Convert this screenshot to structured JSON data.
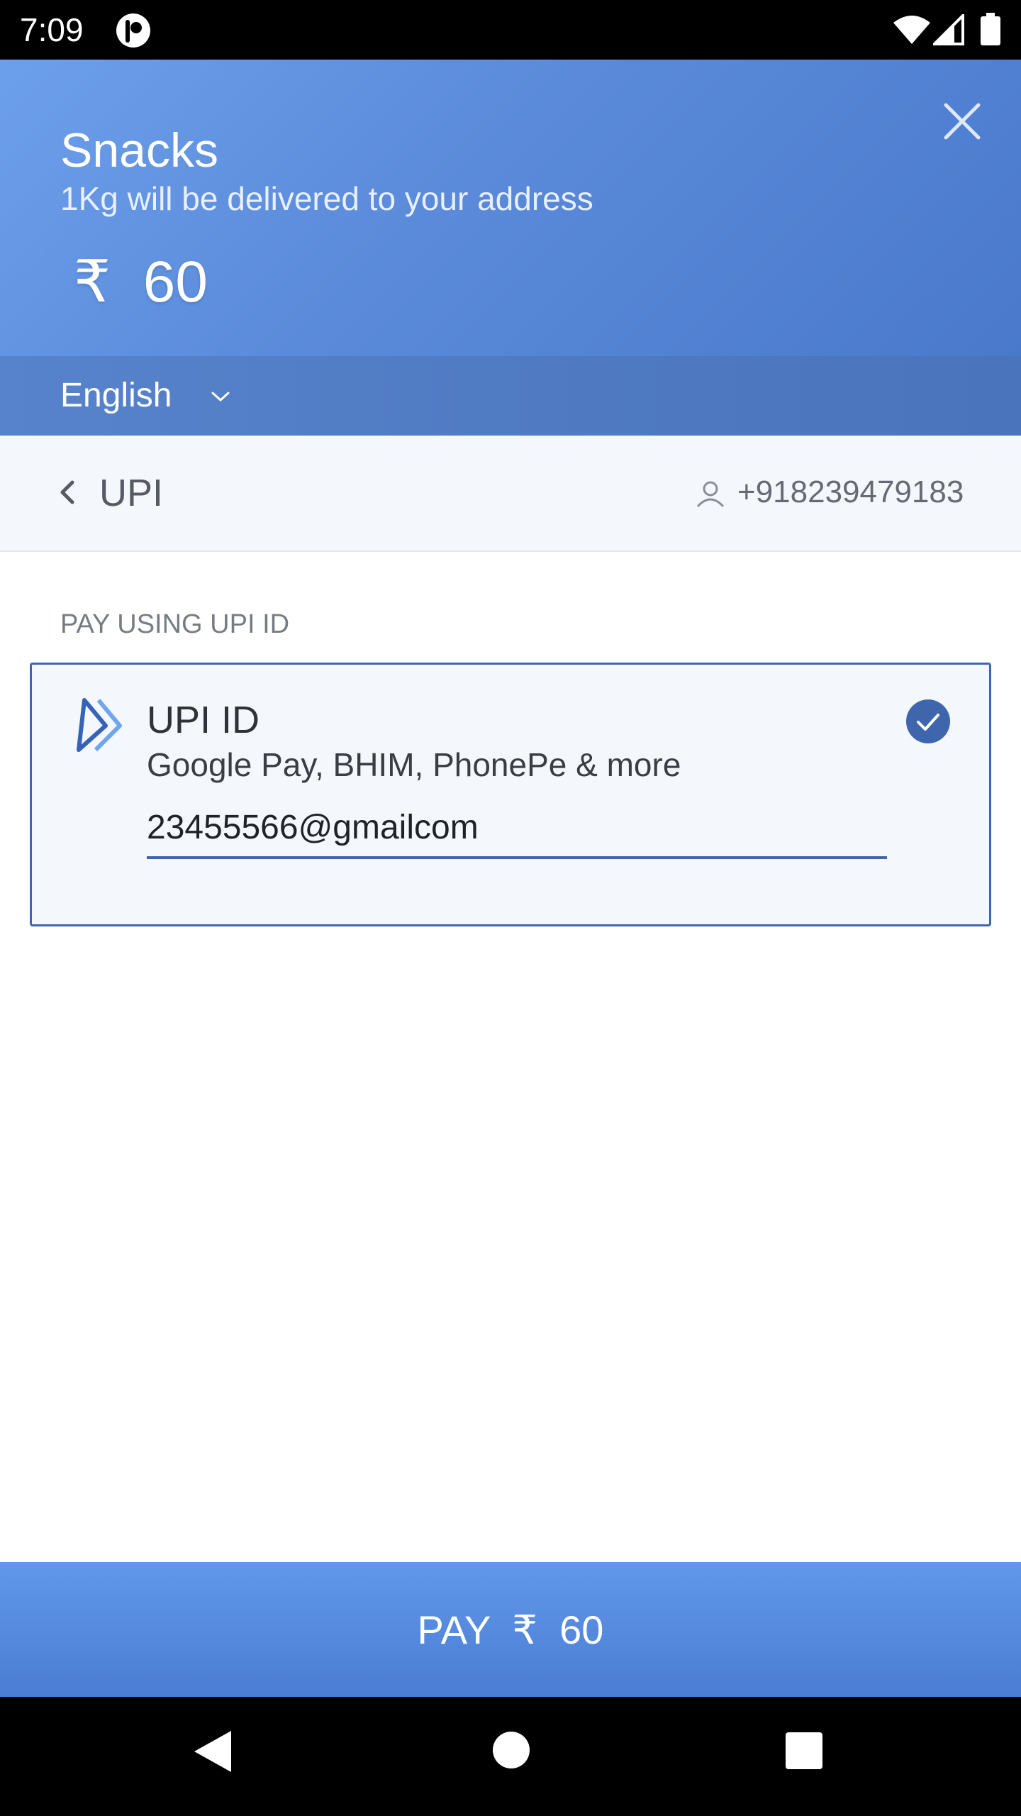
{
  "status_bar": {
    "time": "7:09",
    "icons": [
      "app-notification-icon",
      "wifi-icon",
      "signal-icon",
      "battery-icon"
    ]
  },
  "header": {
    "title": "Snacks",
    "subtitle": "1Kg will be delivered to your address",
    "amount": "₹  60",
    "close_icon": "close-icon",
    "background_colors": [
      "#6c9fec",
      "#4a79cc"
    ]
  },
  "language": {
    "selected": "English",
    "icon": "chevron-down-icon"
  },
  "upi_nav": {
    "title": "UPI",
    "back_icon": "chevron-left-icon",
    "user_icon": "user-icon",
    "phone": "+918239479183"
  },
  "section_label": "PAY USING UPI ID",
  "upi_option": {
    "title": "UPI ID",
    "subtitle": "Google Pay, BHIM, PhonePe & more",
    "input_value": "23455566@gmailcom",
    "selected": true,
    "accent_color": "#3f66ad"
  },
  "pay_button": {
    "label": "PAY  ₹  60"
  },
  "nav_bar": {
    "icons": [
      "back-triangle-icon",
      "home-circle-icon",
      "recents-square-icon"
    ]
  }
}
